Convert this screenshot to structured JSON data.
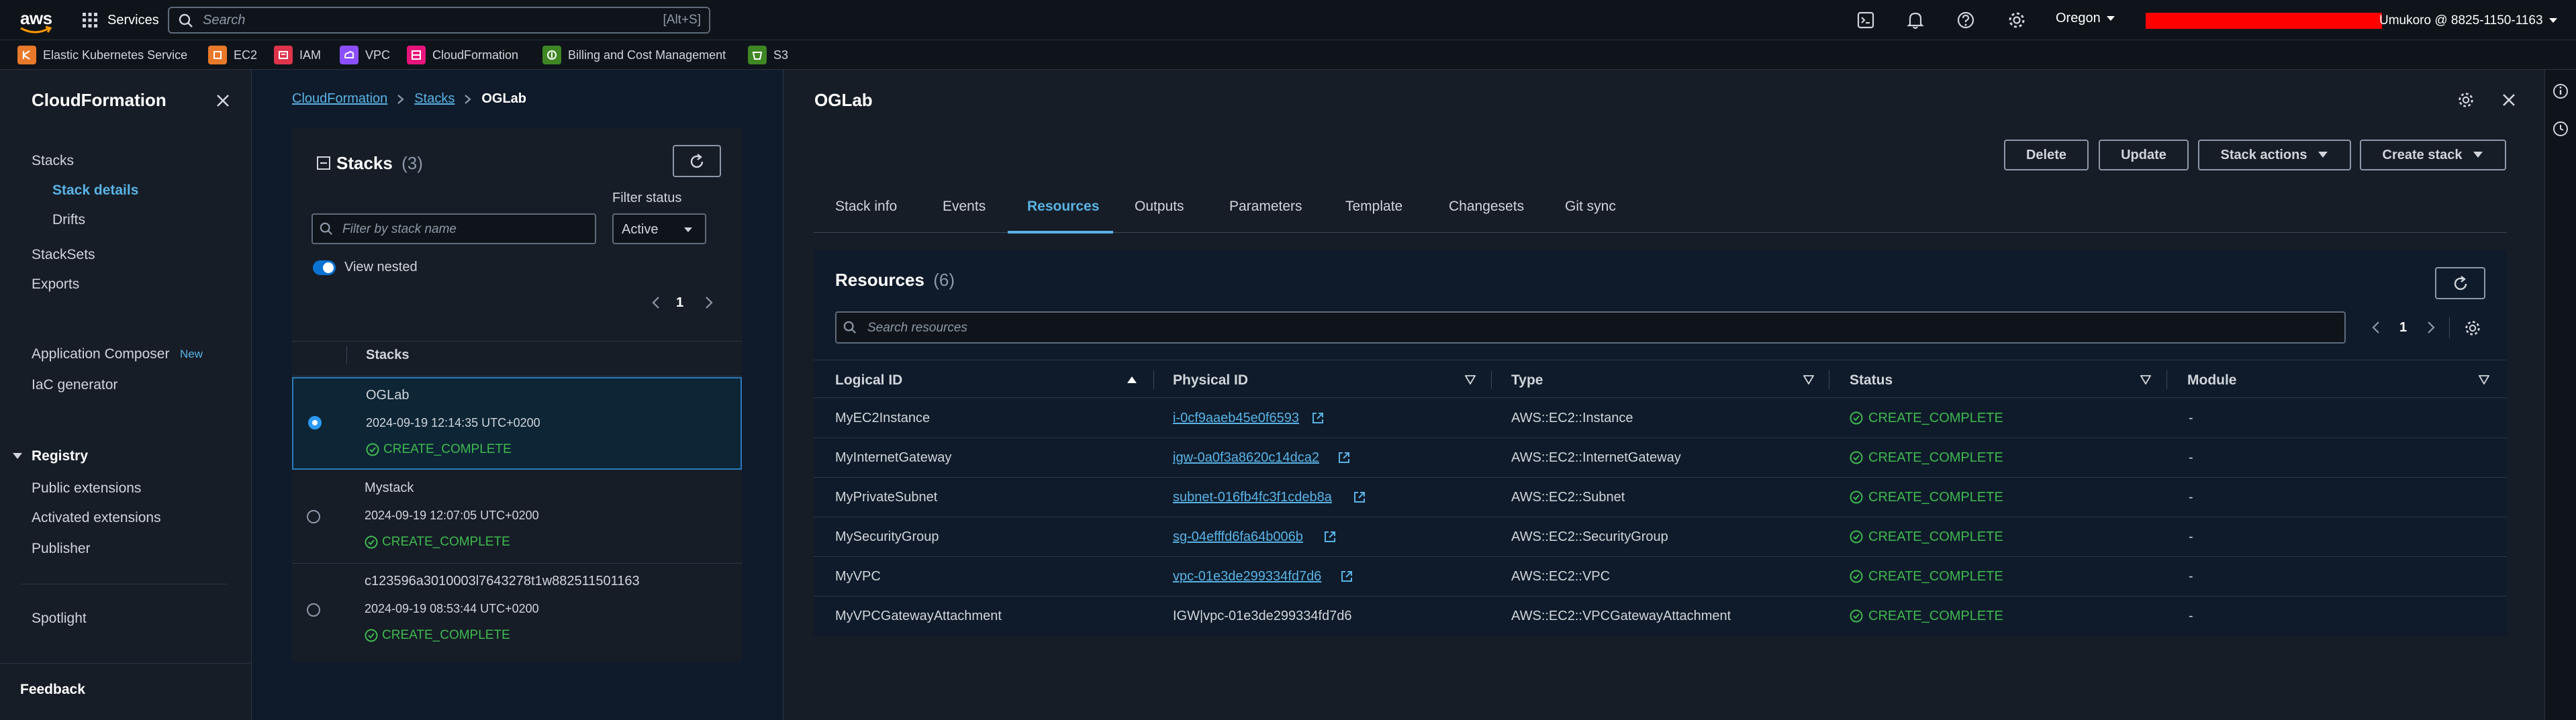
{
  "topnav": {
    "logo": "aws",
    "services_label": "Services",
    "search_placeholder": "Search",
    "search_shortcut": "[Alt+S]",
    "region": "Oregon",
    "account": "Umukoro @ 8825-1150-1163",
    "icons": [
      "cloudshell-icon",
      "bell-icon",
      "help-icon",
      "gear-icon"
    ]
  },
  "favorites": [
    {
      "label": "Elastic Kubernetes Service",
      "color": "#e8792a"
    },
    {
      "label": "EC2",
      "color": "#e8792a"
    },
    {
      "label": "IAM",
      "color": "#dd344c"
    },
    {
      "label": "VPC",
      "color": "#8c4fff"
    },
    {
      "label": "CloudFormation",
      "color": "#e7157b"
    },
    {
      "label": "Billing and Cost Management",
      "color": "#3f8624"
    },
    {
      "label": "S3",
      "color": "#3f8624"
    }
  ],
  "sidenav": {
    "title": "CloudFormation",
    "items": [
      "Stacks",
      "Stack details",
      "Drifts",
      "StackSets",
      "Exports"
    ],
    "items2": [
      "Application Composer",
      "IaC generator"
    ],
    "new_badge": "New",
    "registry": "Registry",
    "registry_items": [
      "Public extensions",
      "Activated extensions",
      "Publisher"
    ],
    "spotlight": "Spotlight",
    "feedback": "Feedback"
  },
  "breadcrumb": [
    "CloudFormation",
    "Stacks",
    "OGLab"
  ],
  "stacks_panel": {
    "title": "Stacks",
    "count": "(3)",
    "filter_placeholder": "Filter by stack name",
    "filter_status_label": "Filter status",
    "filter_status_value": "Active",
    "view_nested": "View nested",
    "page": "1",
    "column_header": "Stacks",
    "stacks": [
      {
        "name": "OGLab",
        "date": "2024-09-19 12:14:35 UTC+0200",
        "status": "CREATE_COMPLETE"
      },
      {
        "name": "Mystack",
        "date": "2024-09-19 12:07:05 UTC+0200",
        "status": "CREATE_COMPLETE"
      },
      {
        "name": "c123596a3010003l7643278t1w882511501163",
        "date": "2024-09-19 08:53:44 UTC+0200",
        "status": "CREATE_COMPLETE"
      }
    ]
  },
  "detail": {
    "title": "OGLab",
    "buttons": {
      "delete": "Delete",
      "update": "Update",
      "stack_actions": "Stack actions",
      "create_stack": "Create stack"
    },
    "tabs": [
      "Stack info",
      "Events",
      "Resources",
      "Outputs",
      "Parameters",
      "Template",
      "Changesets",
      "Git sync"
    ],
    "active_tab": "Resources",
    "resources_title": "Resources",
    "resources_count": "(6)",
    "search_placeholder": "Search resources",
    "page": "1",
    "columns": [
      "Logical ID",
      "Physical ID",
      "Type",
      "Status",
      "Module"
    ],
    "rows": [
      {
        "logical": "MyEC2Instance",
        "physical": "i-0cf9aaeb45e0f6593",
        "link": true,
        "type": "AWS::EC2::Instance",
        "status": "CREATE_COMPLETE",
        "module": "-"
      },
      {
        "logical": "MyInternetGateway",
        "physical": "igw-0a0f3a8620c14dca2",
        "link": true,
        "type": "AWS::EC2::InternetGateway",
        "status": "CREATE_COMPLETE",
        "module": "-"
      },
      {
        "logical": "MyPrivateSubnet",
        "physical": "subnet-016fb4fc3f1cdeb8a",
        "link": true,
        "type": "AWS::EC2::Subnet",
        "status": "CREATE_COMPLETE",
        "module": "-"
      },
      {
        "logical": "MySecurityGroup",
        "physical": "sg-04efffd6fa64b006b",
        "link": true,
        "type": "AWS::EC2::SecurityGroup",
        "status": "CREATE_COMPLETE",
        "module": "-"
      },
      {
        "logical": "MyVPC",
        "physical": "vpc-01e3de299334fd7d6",
        "link": true,
        "type": "AWS::EC2::VPC",
        "status": "CREATE_COMPLETE",
        "module": "-"
      },
      {
        "logical": "MyVPCGatewayAttachment",
        "physical": "IGW|vpc-01e3de299334fd7d6",
        "link": false,
        "type": "AWS::EC2::VPCGatewayAttachment",
        "status": "CREATE_COMPLETE",
        "module": "-"
      }
    ]
  },
  "colors": {
    "accent": "#5ab3e6",
    "success": "#3fb950",
    "redacted": "#ff0000"
  }
}
